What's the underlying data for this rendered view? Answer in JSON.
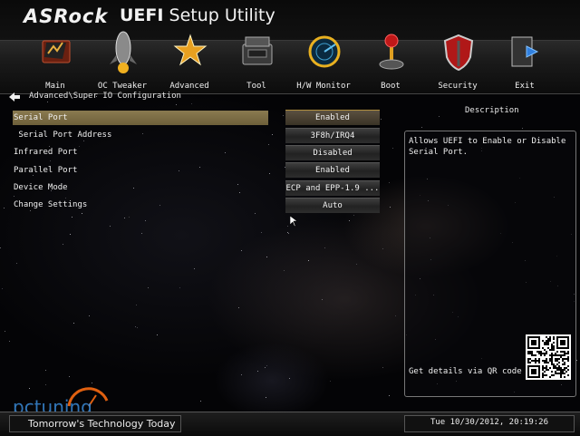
{
  "header": {
    "brand": "ASRock",
    "title_bold": "UEFI",
    "title_rest": "Setup Utility"
  },
  "menu": [
    {
      "label": "Main",
      "icon": "main-icon"
    },
    {
      "label": "OC Tweaker",
      "icon": "rocket-icon"
    },
    {
      "label": "Advanced",
      "icon": "star-icon"
    },
    {
      "label": "Tool",
      "icon": "toolbox-icon"
    },
    {
      "label": "H/W Monitor",
      "icon": "radar-icon"
    },
    {
      "label": "Boot",
      "icon": "joystick-icon"
    },
    {
      "label": "Security",
      "icon": "shield-icon"
    },
    {
      "label": "Exit",
      "icon": "exit-door-icon"
    }
  ],
  "breadcrumb": "Advanced\\Super IO Configuration",
  "settings": [
    {
      "label": "Serial Port",
      "value": "Enabled"
    },
    {
      "label": " Serial Port Address",
      "value": "3F8h/IRQ4"
    },
    {
      "label": "Infrared Port",
      "value": "Disabled"
    },
    {
      "label": "Parallel Port",
      "value": "Enabled"
    },
    {
      "label": "Device Mode",
      "value": "ECP and EPP-1.9 ..."
    },
    {
      "label": "Change Settings",
      "value": "Auto"
    }
  ],
  "description": {
    "title": "Description",
    "text": "Allows UEFI to Enable or Disable Serial Port.",
    "qr_label": "Get details via QR code"
  },
  "footer": {
    "slogan": "Tomorrow's Technology Today",
    "clock": "Tue 10/30/2012, 20:19:26"
  },
  "watermark": "pctuning",
  "colors": {
    "selected": "#8a7a50",
    "accent": "#e0a020"
  }
}
